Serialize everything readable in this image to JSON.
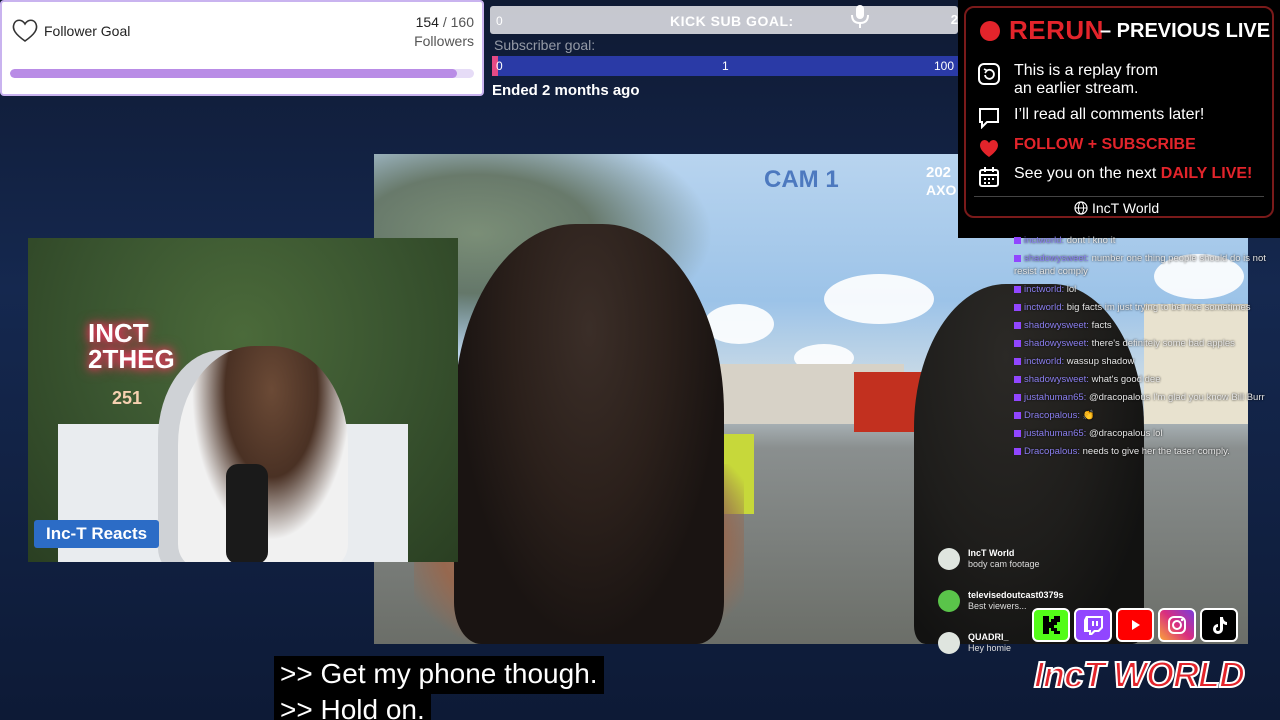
{
  "follower_goal": {
    "title": "Follower Goal",
    "current": "154",
    "target": "160",
    "separator": "/",
    "unit": "Followers",
    "progress_fraction": 0.9625
  },
  "sub_goal": {
    "left_count": "0",
    "banner": "KICK SUB GOAL:",
    "right_count": "2",
    "label": "Subscriber goal:",
    "bar_start": "0",
    "bar_mid": "1",
    "bar_end": "100",
    "status": "Ended 2 months ago"
  },
  "rerun": {
    "title": "RERUN",
    "subtitle": "– PREVIOUS LIVE",
    "line1": "This is a replay from",
    "line1b": "an earlier stream.",
    "line2": "I’ll read all comments later!",
    "line3": "FOLLOW + SUBSCRIBE",
    "line4_prefix": "See you on the next ",
    "line4_highlight": "DAILY LIVE!",
    "footer": "IncT World"
  },
  "footage": {
    "cam_label": "CAM 1",
    "year": "202",
    "code": "AXO"
  },
  "webcam": {
    "neon_line1": "INCT",
    "neon_line2": "2THEG",
    "neon_line3": "251",
    "tag": "Inc-T Reacts"
  },
  "chat": [
    {
      "user": "inctworld:",
      "text": " dont i kno it"
    },
    {
      "user": "shadowysweet:",
      "text": " number one thing people should do is not resist and comply"
    },
    {
      "user": "inctworld:",
      "text": " lol"
    },
    {
      "user": "inctworld:",
      "text": " big facts im just trying to be nice sometimes"
    },
    {
      "user": "shadowysweet:",
      "text": " facts"
    },
    {
      "user": "shadowysweet:",
      "text": " there's definitely some bad apples"
    },
    {
      "user": "inctworld:",
      "text": " wassup shadow"
    },
    {
      "user": "shadowysweet:",
      "text": " what's good dee"
    },
    {
      "user": "justahuman65:",
      "text": " @dracopalous I'm glad you know Bill Burr"
    },
    {
      "user": "Dracopalous:",
      "text": " 👏"
    },
    {
      "user": "justahuman65:",
      "text": " @dracopalous lol"
    },
    {
      "user": "Dracopalous:",
      "text": " needs to give her the taser comply."
    }
  ],
  "chat_overlay": [
    {
      "name": "IncT World",
      "msg": "body cam footage"
    },
    {
      "name": "televisedoutcast0379s",
      "msg": "Best viewers..."
    },
    {
      "name": "QUADRI_",
      "msg": "Hey homie"
    }
  ],
  "socials": [
    "kick-icon",
    "twitch-icon",
    "youtube-icon",
    "instagram-icon",
    "tiktok-icon"
  ],
  "brand": "IncT WORLD",
  "captions": [
    ">> Get my phone though.",
    ">> Hold on."
  ],
  "colors": {
    "accent_red": "#e3242b",
    "goal_purple": "#b98ce6",
    "sub_bar_blue": "#2a3aa6",
    "webcam_tag_blue": "#2c6cc6"
  }
}
